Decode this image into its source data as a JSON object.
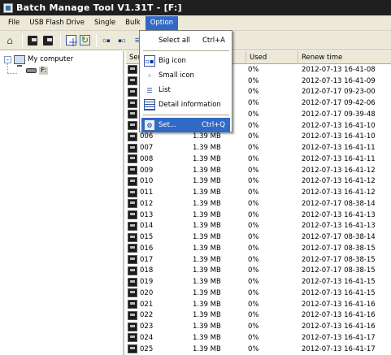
{
  "window": {
    "title": "Batch Manage Tool V1.31T  - [F:]"
  },
  "menubar": [
    "File",
    "USB Flash Drive",
    "Single",
    "Bulk",
    "Option"
  ],
  "option_menu": {
    "items": [
      {
        "label": "Select all",
        "shortcut": "Ctrl+A",
        "icon": "none"
      },
      {
        "label": "Big icon",
        "shortcut": "",
        "icon": "big-icon-view-icon"
      },
      {
        "label": "Small icon",
        "shortcut": "",
        "icon": "small-icon-view-icon"
      },
      {
        "label": "List",
        "shortcut": "",
        "icon": "list-view-icon"
      },
      {
        "label": "Detail information",
        "shortcut": "",
        "icon": "detail-view-icon"
      },
      {
        "label": "Set...",
        "shortcut": "Ctrl+Q",
        "icon": "settings-icon"
      }
    ]
  },
  "tree": {
    "root": "My computer",
    "expander": "-",
    "child": "F:"
  },
  "grid": {
    "columns": [
      "Ser",
      "",
      "Used",
      "Renew time"
    ],
    "rows": [
      {
        "serial": "",
        "size": "",
        "used": "0%",
        "renew": "2012-07-13 16-41-08"
      },
      {
        "serial": "",
        "size": "",
        "used": "0%",
        "renew": "2012-07-13 16-41-09"
      },
      {
        "serial": "",
        "size": "",
        "used": "0%",
        "renew": "2012-07-17 09-23-00"
      },
      {
        "serial": "",
        "size": "",
        "used": "0%",
        "renew": "2012-07-17 09-42-06"
      },
      {
        "serial": "",
        "size": "",
        "used": "0%",
        "renew": "2012-07-17 09-39-48"
      },
      {
        "serial": "",
        "size": "",
        "used": "0%",
        "renew": "2012-07-13 16-41-10"
      },
      {
        "serial": "006",
        "size": "1.39 MB",
        "used": "0%",
        "renew": "2012-07-13 16-41-10"
      },
      {
        "serial": "007",
        "size": "1.39 MB",
        "used": "0%",
        "renew": "2012-07-13 16-41-11"
      },
      {
        "serial": "008",
        "size": "1.39 MB",
        "used": "0%",
        "renew": "2012-07-13 16-41-11"
      },
      {
        "serial": "009",
        "size": "1.39 MB",
        "used": "0%",
        "renew": "2012-07-13 16-41-12"
      },
      {
        "serial": "010",
        "size": "1.39 MB",
        "used": "0%",
        "renew": "2012-07-13 16-41-12"
      },
      {
        "serial": "011",
        "size": "1.39 MB",
        "used": "0%",
        "renew": "2012-07-13 16-41-12"
      },
      {
        "serial": "012",
        "size": "1.39 MB",
        "used": "0%",
        "renew": "2012-07-17 08-38-14"
      },
      {
        "serial": "013",
        "size": "1.39 MB",
        "used": "0%",
        "renew": "2012-07-13 16-41-13"
      },
      {
        "serial": "014",
        "size": "1.39 MB",
        "used": "0%",
        "renew": "2012-07-13 16-41-13"
      },
      {
        "serial": "015",
        "size": "1.39 MB",
        "used": "0%",
        "renew": "2012-07-17 08-38-14"
      },
      {
        "serial": "016",
        "size": "1.39 MB",
        "used": "0%",
        "renew": "2012-07-17 08-38-15"
      },
      {
        "serial": "017",
        "size": "1.39 MB",
        "used": "0%",
        "renew": "2012-07-17 08-38-15"
      },
      {
        "serial": "018",
        "size": "1.39 MB",
        "used": "0%",
        "renew": "2012-07-17 08-38-15"
      },
      {
        "serial": "019",
        "size": "1.39 MB",
        "used": "0%",
        "renew": "2012-07-13 16-41-15"
      },
      {
        "serial": "020",
        "size": "1.39 MB",
        "used": "0%",
        "renew": "2012-07-13 16-41-15"
      },
      {
        "serial": "021",
        "size": "1.39 MB",
        "used": "0%",
        "renew": "2012-07-13 16-41-16"
      },
      {
        "serial": "022",
        "size": "1.39 MB",
        "used": "0%",
        "renew": "2012-07-13 16-41-16"
      },
      {
        "serial": "023",
        "size": "1.39 MB",
        "used": "0%",
        "renew": "2012-07-13 16-41-16"
      },
      {
        "serial": "024",
        "size": "1.39 MB",
        "used": "0%",
        "renew": "2012-07-13 16-41-17"
      },
      {
        "serial": "025",
        "size": "1.39 MB",
        "used": "0%",
        "renew": "2012-07-13 16-41-17"
      }
    ]
  },
  "colors": {
    "titlebar": "#1f1f1f",
    "menu_highlight": "#316ac5",
    "chrome": "#ece9d8"
  }
}
